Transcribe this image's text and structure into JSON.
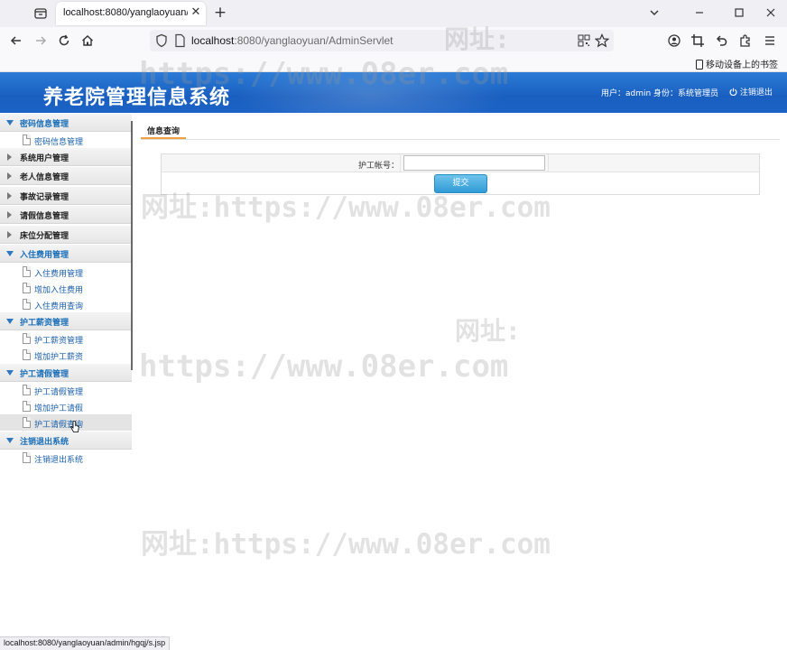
{
  "browser": {
    "tab_title": "localhost:8080/yanglaoyuan/AdminServlet",
    "url_host": "localhost",
    "url_rest": ":8080/yanglaoyuan/AdminServlet",
    "mobile_bookmarks": "移动设备上的书签",
    "status_url": "localhost:8080/yanglaoyuan/admin/hgqj/s.jsp"
  },
  "header": {
    "title": "养老院管理信息系统",
    "user_info": "用户：admin 身份：系统管理员",
    "logout": "注销退出"
  },
  "sidebar": {
    "groups": [
      {
        "label": "密码信息管理",
        "open": true,
        "items": [
          "密码信息管理"
        ]
      },
      {
        "label": "系统用户管理",
        "open": false,
        "items": []
      },
      {
        "label": "老人信息管理",
        "open": false,
        "items": []
      },
      {
        "label": "事故记录管理",
        "open": false,
        "items": []
      },
      {
        "label": "请假信息管理",
        "open": false,
        "items": []
      },
      {
        "label": "床位分配管理",
        "open": false,
        "items": []
      },
      {
        "label": "入住费用管理",
        "open": true,
        "items": [
          "入住费用管理",
          "增加入住费用",
          "入住费用查询"
        ]
      },
      {
        "label": "护工薪资管理",
        "open": true,
        "items": [
          "护工薪资管理",
          "增加护工薪资"
        ]
      },
      {
        "label": "护工请假管理",
        "open": true,
        "items": [
          "护工请假管理",
          "增加护工请假",
          "护工请假查询"
        ]
      },
      {
        "label": "注销退出系统",
        "open": true,
        "items": [
          "注销退出系统"
        ]
      }
    ]
  },
  "main": {
    "tab_label": "信息查询",
    "field_label": "护工帐号：",
    "field_value": "",
    "submit_label": "提交"
  },
  "watermarks": {
    "wm1": "网址:",
    "wm2": "https://www.08er.com",
    "wm3": "网址:https://www.08er.com",
    "wm4": "网址:",
    "wm5": "https://www.08er.com",
    "wm6": "网址:https://www.08er.com"
  },
  "colors": {
    "header_blue": "#1a5fc0",
    "sidebar_link": "#1a5fa8",
    "tab_underline": "#f0a040",
    "button_blue": "#2f9bd6"
  }
}
